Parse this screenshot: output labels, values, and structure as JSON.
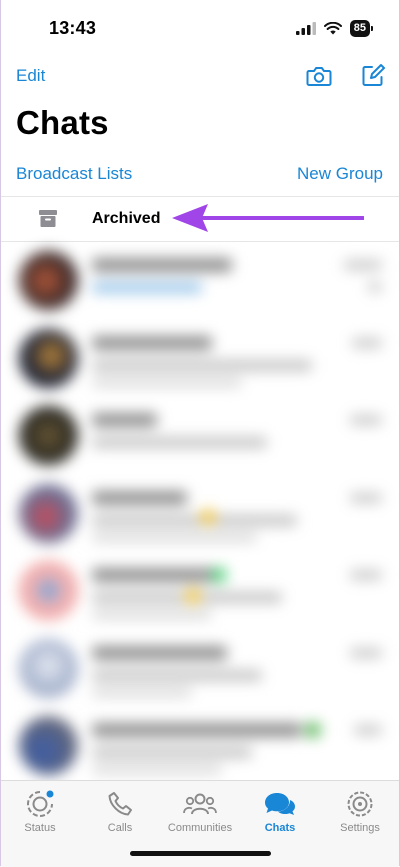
{
  "status_bar": {
    "time": "13:43",
    "battery": "85"
  },
  "header": {
    "edit_label": "Edit",
    "title": "Chats"
  },
  "links": {
    "broadcast": "Broadcast Lists",
    "new_group": "New Group"
  },
  "archived": {
    "label": "Archived"
  },
  "tabs": [
    {
      "label": "Status",
      "icon": "status-icon"
    },
    {
      "label": "Calls",
      "icon": "phone-icon"
    },
    {
      "label": "Communities",
      "icon": "communities-icon"
    },
    {
      "label": "Chats",
      "icon": "chats-icon"
    },
    {
      "label": "Settings",
      "icon": "gear-icon"
    }
  ],
  "colors": {
    "accent": "#1a86d6",
    "arrow": "#a046e8"
  }
}
